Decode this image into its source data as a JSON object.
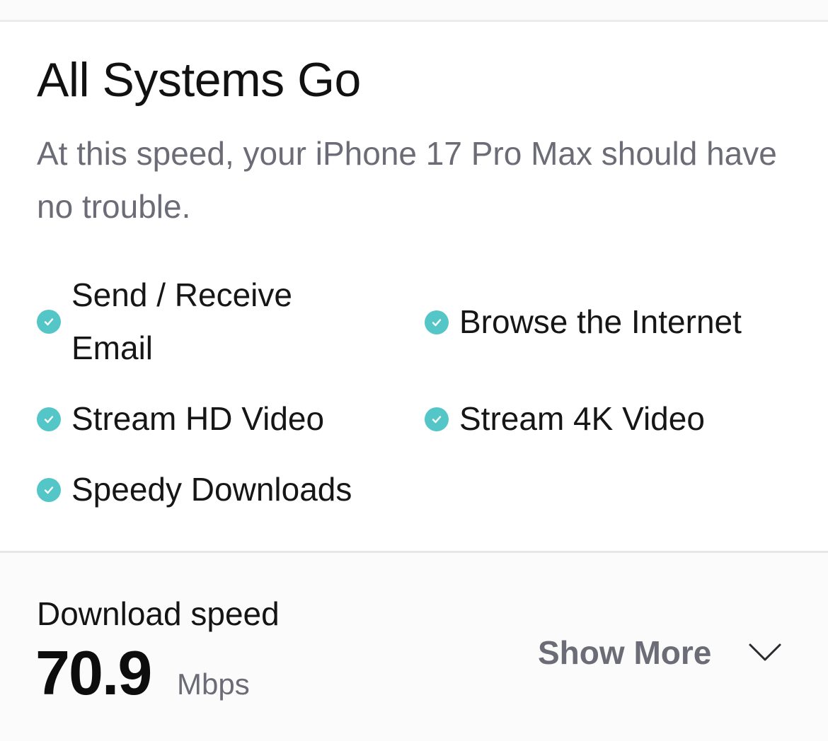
{
  "status": {
    "title": "All Systems Go",
    "subtitle": "At this speed, your iPhone 17 Pro Max should have no trouble."
  },
  "features": [
    {
      "label": "Send / Receive Email",
      "icon": "check-circle-icon"
    },
    {
      "label": "Browse the Internet",
      "icon": "check-circle-icon"
    },
    {
      "label": "Stream HD Video",
      "icon": "check-circle-icon"
    },
    {
      "label": "Stream 4K Video",
      "icon": "check-circle-icon"
    },
    {
      "label": "Speedy Downloads",
      "icon": "check-circle-icon"
    }
  ],
  "download": {
    "label": "Download speed",
    "value": "70.9",
    "unit": "Mbps"
  },
  "show_more": {
    "label": "Show More",
    "icon": "chevron-down-icon"
  },
  "colors": {
    "check": "#55c6c7",
    "muted_text": "#6c6c76",
    "primary_text": "#111111"
  }
}
